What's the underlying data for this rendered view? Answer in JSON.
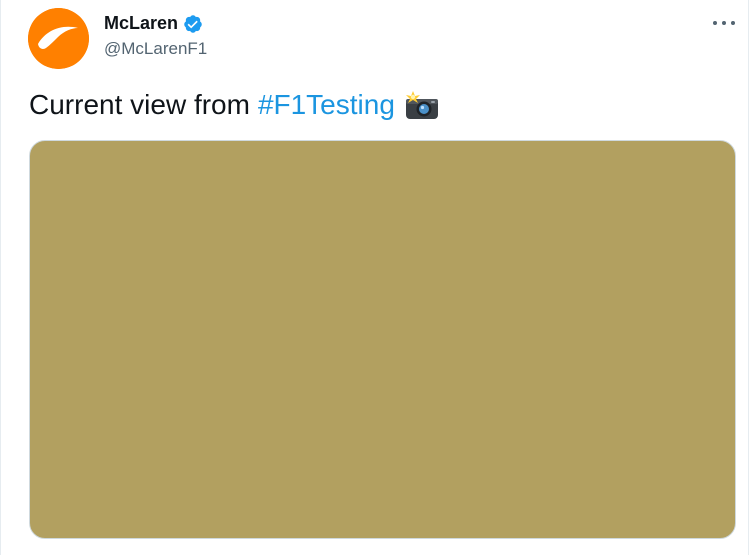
{
  "tweet": {
    "author": {
      "display_name": "McLaren",
      "handle": "@McLarenF1",
      "verified": true,
      "avatar_icon": "mclaren-speedmark-logo",
      "avatar_color": "#ff8000"
    },
    "text": {
      "body": "Current view from",
      "hashtag": "#F1Testing",
      "emoji_icon": "camera-with-flash-icon"
    },
    "media": {
      "color": "#b2a060"
    },
    "menu_icon": "more-options-icon"
  },
  "colors": {
    "hashtag": "#1b95e0",
    "verified": "#1d9bf0",
    "secondary_text": "#536471"
  }
}
